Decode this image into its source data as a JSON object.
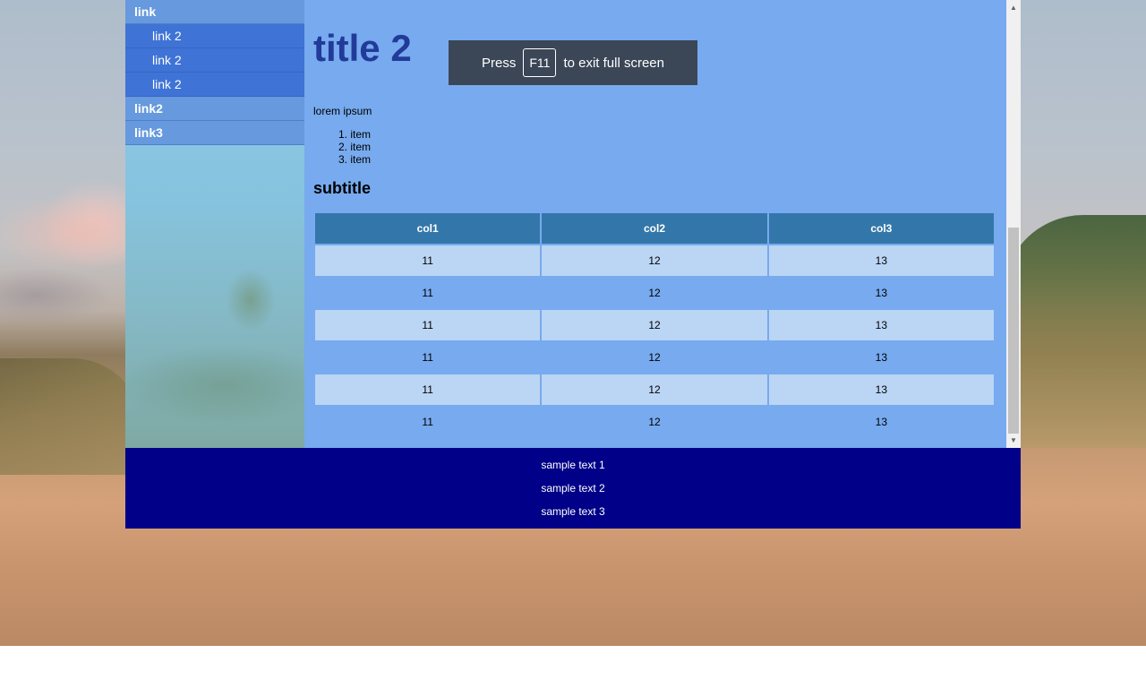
{
  "sidebar": {
    "items": [
      {
        "label": "link"
      },
      {
        "label": "link 2"
      },
      {
        "label": "link 2"
      },
      {
        "label": "link 2"
      },
      {
        "label": "link2"
      },
      {
        "label": "link3"
      }
    ]
  },
  "main": {
    "title": "title 2",
    "intro": "lorem ipsum",
    "list": [
      "1. item",
      "2. item",
      "3. item"
    ],
    "subtitle": "subtitle",
    "table": {
      "headers": [
        "col1",
        "col2",
        "col3"
      ],
      "rows": [
        [
          "11",
          "12",
          "13"
        ],
        [
          "11",
          "12",
          "13"
        ],
        [
          "11",
          "12",
          "13"
        ],
        [
          "11",
          "12",
          "13"
        ],
        [
          "11",
          "12",
          "13"
        ],
        [
          "11",
          "12",
          "13"
        ]
      ]
    }
  },
  "footer": {
    "lines": [
      "sample text 1",
      "sample text 2",
      "sample text 3"
    ]
  },
  "toast": {
    "prefix": "Press",
    "key": "F11",
    "suffix": "to exit full screen"
  },
  "scrollbar": {
    "up_icon": "▲",
    "down_icon": "▼"
  }
}
